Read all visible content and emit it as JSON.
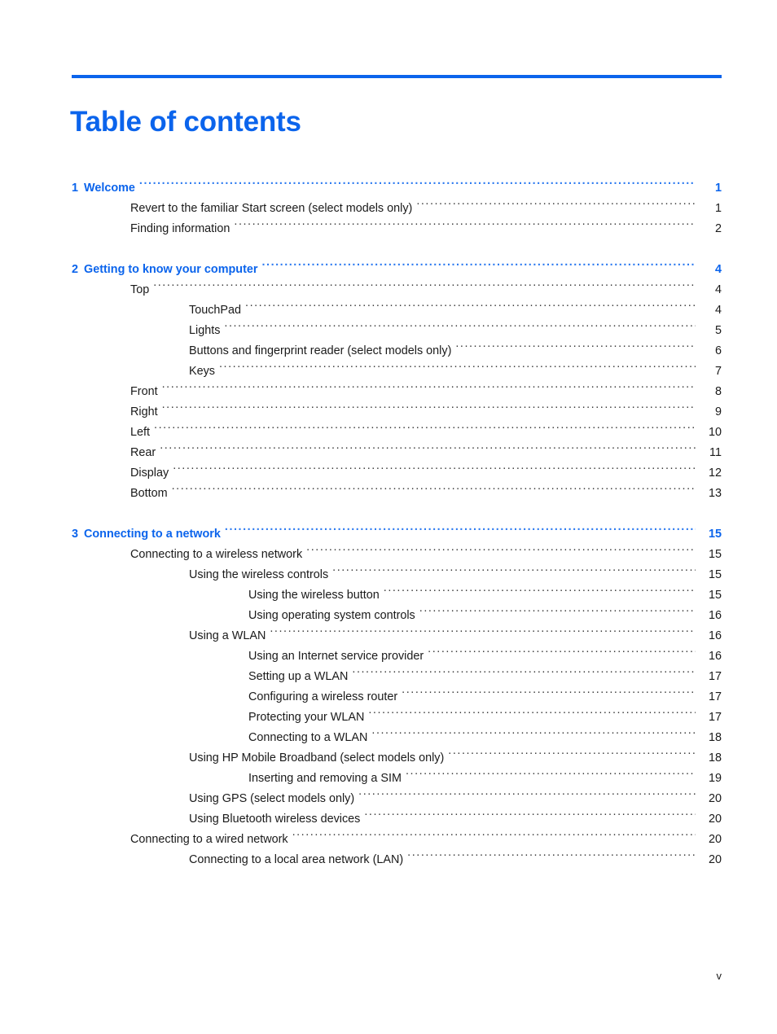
{
  "document": {
    "title": "Table of contents",
    "footer_page_number": "v",
    "accent_color": "#0b64ec",
    "text_color": "#1a1a1a"
  },
  "toc": {
    "entries": [
      {
        "level": 0,
        "number": "1",
        "label": "Welcome",
        "page": "1"
      },
      {
        "level": 1,
        "number": "",
        "label": "Revert to the familiar Start screen (select models only)",
        "page": "1"
      },
      {
        "level": 1,
        "number": "",
        "label": "Finding information",
        "page": "2"
      },
      {
        "level": 0,
        "number": "2",
        "label": "Getting to know your computer",
        "page": "4"
      },
      {
        "level": 1,
        "number": "",
        "label": "Top",
        "page": "4"
      },
      {
        "level": 2,
        "number": "",
        "label": "TouchPad",
        "page": "4"
      },
      {
        "level": 2,
        "number": "",
        "label": "Lights",
        "page": "5"
      },
      {
        "level": 2,
        "number": "",
        "label": "Buttons and fingerprint reader (select models only)",
        "page": "6"
      },
      {
        "level": 2,
        "number": "",
        "label": "Keys",
        "page": "7"
      },
      {
        "level": 1,
        "number": "",
        "label": "Front",
        "page": "8"
      },
      {
        "level": 1,
        "number": "",
        "label": "Right",
        "page": "9"
      },
      {
        "level": 1,
        "number": "",
        "label": "Left",
        "page": "10"
      },
      {
        "level": 1,
        "number": "",
        "label": "Rear",
        "page": "11"
      },
      {
        "level": 1,
        "number": "",
        "label": "Display",
        "page": "12"
      },
      {
        "level": 1,
        "number": "",
        "label": "Bottom",
        "page": "13"
      },
      {
        "level": 0,
        "number": "3",
        "label": "Connecting to a network",
        "page": "15"
      },
      {
        "level": 1,
        "number": "",
        "label": "Connecting to a wireless network",
        "page": "15"
      },
      {
        "level": 2,
        "number": "",
        "label": "Using the wireless controls",
        "page": "15"
      },
      {
        "level": 3,
        "number": "",
        "label": "Using the wireless button",
        "page": "15"
      },
      {
        "level": 3,
        "number": "",
        "label": "Using operating system controls",
        "page": "16"
      },
      {
        "level": 2,
        "number": "",
        "label": "Using a WLAN",
        "page": "16"
      },
      {
        "level": 3,
        "number": "",
        "label": "Using an Internet service provider",
        "page": "16"
      },
      {
        "level": 3,
        "number": "",
        "label": "Setting up a WLAN",
        "page": "17"
      },
      {
        "level": 3,
        "number": "",
        "label": "Configuring a wireless router",
        "page": "17"
      },
      {
        "level": 3,
        "number": "",
        "label": "Protecting your WLAN",
        "page": "17"
      },
      {
        "level": 3,
        "number": "",
        "label": "Connecting to a WLAN",
        "page": "18"
      },
      {
        "level": 2,
        "number": "",
        "label": "Using HP Mobile Broadband (select models only)",
        "page": "18"
      },
      {
        "level": 3,
        "number": "",
        "label": "Inserting and removing a SIM",
        "page": "19"
      },
      {
        "level": 2,
        "number": "",
        "label": "Using GPS (select models only)",
        "page": "20"
      },
      {
        "level": 2,
        "number": "",
        "label": "Using Bluetooth wireless devices",
        "page": "20"
      },
      {
        "level": 1,
        "number": "",
        "label": "Connecting to a wired network",
        "page": "20"
      },
      {
        "level": 2,
        "number": "",
        "label": "Connecting to a local area network (LAN)",
        "page": "20"
      }
    ]
  }
}
